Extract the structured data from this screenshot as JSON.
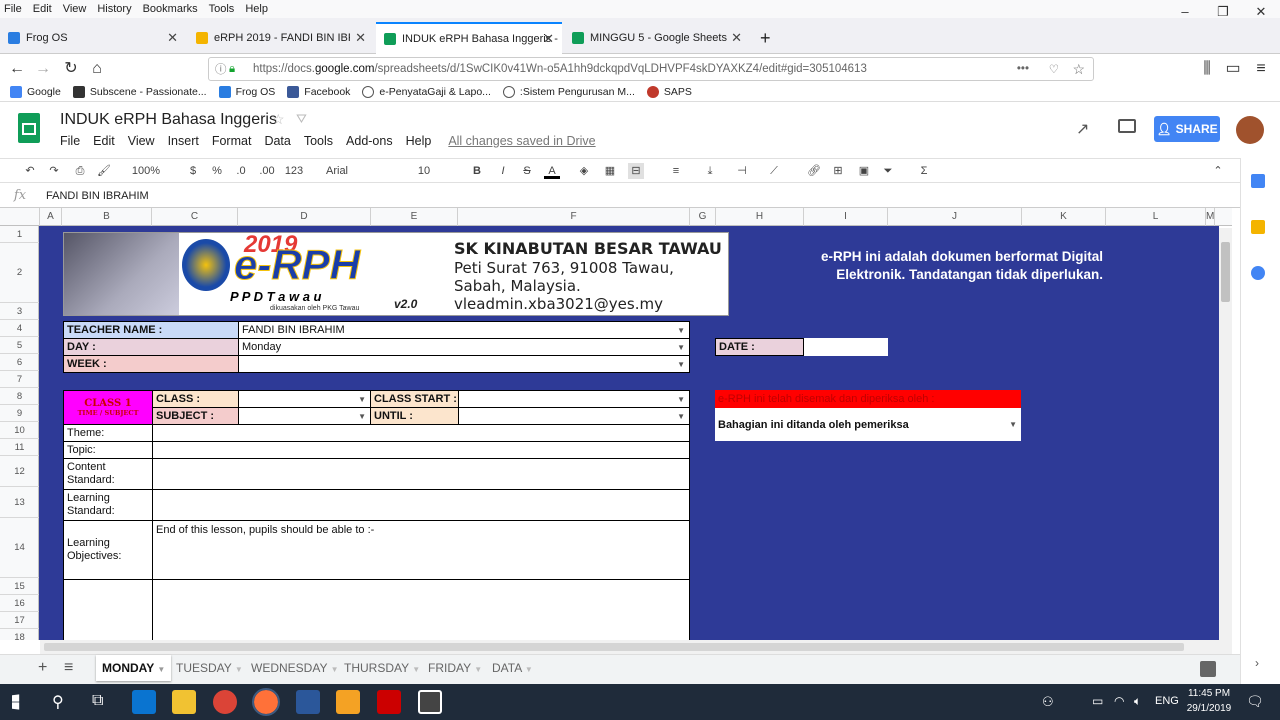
{
  "menubar": [
    "File",
    "Edit",
    "View",
    "History",
    "Bookmarks",
    "Tools",
    "Help"
  ],
  "tabs": [
    {
      "label": "Frog OS",
      "color": "#2a7de1"
    },
    {
      "label": "eRPH 2019 - FANDI BIN IBRAHIM",
      "color": "#f4b400"
    },
    {
      "label": "INDUK eRPH Bahasa Inggeris -",
      "color": "#0f9d58"
    },
    {
      "label": "MINGGU 5 - Google Sheets",
      "color": "#0f9d58"
    }
  ],
  "url": {
    "prefix": "https://docs.",
    "domain": "google.com",
    "rest": "/spreadsheets/d/1SwCIK0v41Wn-o5A1hh9dckqpdVqLDHVPF4skDYAXKZ4/edit#gid=305104613"
  },
  "bookmarks": [
    "Google",
    "Subscene - Passionate...",
    "Frog OS",
    "Facebook",
    "e-PenyataGaji & Lapo...",
    ":Sistem Pengurusan M...",
    "SAPS"
  ],
  "doc": {
    "title": "INDUK eRPH Bahasa Inggeris",
    "menus": [
      "File",
      "Edit",
      "View",
      "Insert",
      "Format",
      "Data",
      "Tools",
      "Add-ons",
      "Help"
    ],
    "saved": "All changes saved in Drive",
    "share": "SHARE"
  },
  "toolbar": {
    "zoom": "100%",
    "currency": "$",
    "percent": "%",
    "dec0": ".0",
    "dec00": ".00",
    "fmt": "123",
    "font": "Arial",
    "size": "10",
    "bold": "B",
    "italic": "I",
    "strike": "S",
    "textcolor": "A"
  },
  "formula": {
    "fx": "fx",
    "value": "FANDI BIN IBRAHIM"
  },
  "columns": [
    "A",
    "B",
    "C",
    "D",
    "E",
    "F",
    "G",
    "H",
    "I",
    "J",
    "K",
    "L",
    "M"
  ],
  "rows": [
    "1",
    "2",
    "3",
    "4",
    "5",
    "6",
    "7",
    "8",
    "9",
    "10",
    "11",
    "12",
    "13",
    "14",
    "15",
    "16",
    "17",
    "18"
  ],
  "banner": {
    "year": "2019",
    "brand": "e-RPH",
    "ppd": "P P D   T a w a u",
    "credit": "dikuasakan oleh PKG Tawau",
    "ver": "v2.0",
    "school": "SK KINABUTAN BESAR TAWAU",
    "addr1": "Peti Surat 763, 91008 Tawau,",
    "addr2": "Sabah, Malaysia.",
    "email": "vleadmin.xba3021@yes.my"
  },
  "note": "e-RPH ini adalah dokumen berformat Digital Elektronik. Tandatangan tidak diperlukan.",
  "form": {
    "teacher_label": "TEACHER NAME :",
    "teacher_value": "FANDI BIN IBRAHIM",
    "day_label": "DAY :",
    "day_value": "Monday",
    "week_label": "WEEK :",
    "date_label": "DATE :",
    "class1": "CLASS 1",
    "class1_sub": "TIME / SUBJECT",
    "class_label": "CLASS :",
    "class_start": "CLASS START :",
    "subject_label": "SUBJECT :",
    "until_label": "UNTIL :",
    "theme": "Theme:",
    "topic": "Topic:",
    "content_std1": "Content",
    "content_std2": "Standard:",
    "learning_std1": "Learning",
    "learning_std2": "Standard:",
    "lo1": "Learning",
    "lo2": "Objectives:",
    "lo_value": "End of this lesson, pupils should be able to :-"
  },
  "review": {
    "header": "e-RPH ini telah disemak dan diperiksa oleh :",
    "value": "Bahagian ini ditanda oleh pemeriksa"
  },
  "sheet_tabs": [
    "MONDAY",
    "TUESDAY",
    "WEDNESDAY",
    "THURSDAY",
    "FRIDAY",
    "DATA"
  ],
  "taskbar": {
    "lang": "ENG",
    "time": "11:45 PM",
    "date": "29/1/2019"
  }
}
